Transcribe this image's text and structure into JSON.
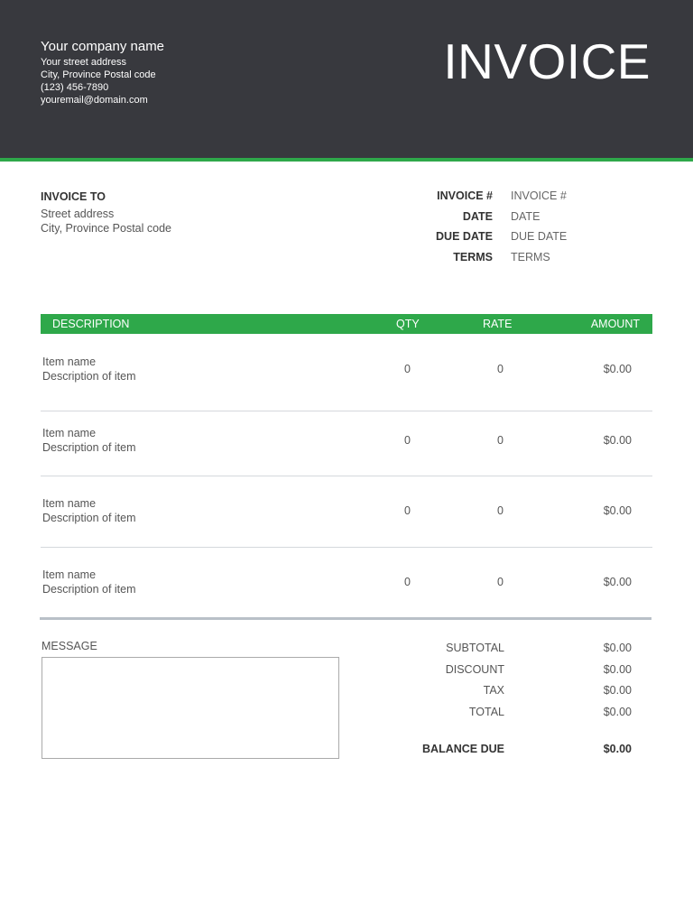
{
  "company": {
    "name": "Your company name",
    "street": "Your street address",
    "city": "City, Province Postal code",
    "phone": "(123) 456-7890",
    "email": "youremail@domain.com"
  },
  "title": "INVOICE",
  "bill_to": {
    "label": "INVOICE TO",
    "street": "Street address",
    "city": "City, Province Postal code"
  },
  "meta": [
    {
      "key": "INVOICE #",
      "value": "INVOICE #"
    },
    {
      "key": "DATE",
      "value": "DATE"
    },
    {
      "key": "DUE DATE",
      "value": "DUE DATE"
    },
    {
      "key": "TERMS",
      "value": "TERMS"
    }
  ],
  "table": {
    "headers": {
      "description": "DESCRIPTION",
      "qty": "QTY",
      "rate": "RATE",
      "amount": "AMOUNT"
    },
    "rows": [
      {
        "name": "Item name",
        "desc": "Description of item",
        "qty": "0",
        "rate": "0",
        "amount": "$0.00"
      },
      {
        "name": "Item name",
        "desc": "Description of item",
        "qty": "0",
        "rate": "0",
        "amount": "$0.00"
      },
      {
        "name": "Item name",
        "desc": "Description of item",
        "qty": "0",
        "rate": "0",
        "amount": "$0.00"
      },
      {
        "name": "Item name",
        "desc": "Description of item",
        "qty": "0",
        "rate": "0",
        "amount": "$0.00"
      }
    ]
  },
  "message": {
    "label": "MESSAGE",
    "value": ""
  },
  "totals": {
    "subtotal": {
      "label": "SUBTOTAL",
      "value": "$0.00"
    },
    "discount": {
      "label": "DISCOUNT",
      "value": "$0.00"
    },
    "tax": {
      "label": "TAX",
      "value": "$0.00"
    },
    "total": {
      "label": "TOTAL",
      "value": "$0.00"
    },
    "balance_due": {
      "label": "BALANCE DUE",
      "value": "$0.00"
    }
  },
  "colors": {
    "header_bg": "#38393e",
    "accent_green": "#2ea84a"
  }
}
